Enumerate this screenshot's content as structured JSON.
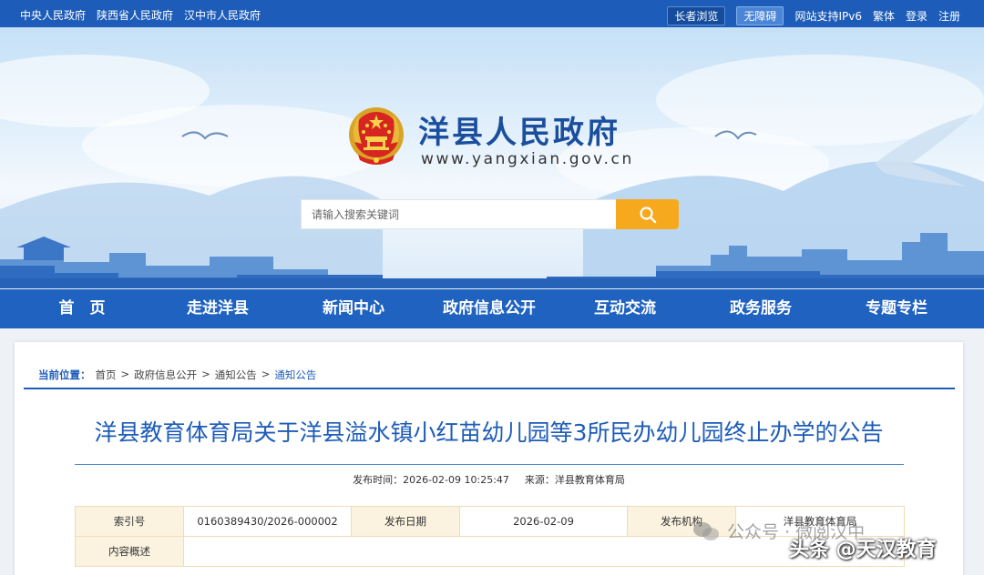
{
  "topbar": {
    "links": [
      "中央人民政府",
      "陕西省人民政府",
      "汉中市人民政府"
    ],
    "elder_mode": "长者浏览",
    "accessible": "无障碍",
    "ipv6": "网站支持IPv6",
    "traditional": "繁体",
    "login": "登录",
    "register": "注册"
  },
  "header": {
    "site_title": "洋县人民政府",
    "site_url": "www.yangxian.gov.cn"
  },
  "search": {
    "placeholder": "请输入搜索关键词",
    "icon": "search-icon"
  },
  "nav": {
    "items": [
      "首　页",
      "走进洋县",
      "新闻中心",
      "政府信息公开",
      "互动交流",
      "政务服务",
      "专题专栏"
    ]
  },
  "breadcrumb": {
    "label": "当前位置：",
    "items": [
      "首页",
      "政府信息公开",
      "通知公告"
    ],
    "separator": ">",
    "current": "通知公告"
  },
  "article": {
    "title": "洋县教育体育局关于洋县溢水镇小红苗幼儿园等3所民办幼儿园终止办学的公告",
    "publish_label": "发布时间：",
    "publish_time": "2026-02-09 10:25:47",
    "source_label": "来源：",
    "source": "洋县教育体育局"
  },
  "info_table": {
    "index_label": "索引号",
    "index_value": "0160389430/2026-000002",
    "date_label": "发布日期",
    "date_value": "2026-02-09",
    "org_label": "发布机构",
    "org_value": "洋县教育体育局",
    "summary_label": "内容概述",
    "summary_value": ""
  },
  "watermark": {
    "wechat": "公众号 · 微阅汉中",
    "toutiao": "头条 @天汉教育"
  },
  "colors": {
    "primary": "#1d5cb8",
    "nav": "#1f62bf",
    "search_button": "#f7a91e",
    "table_border": "#f1dcb5",
    "table_key_bg": "#fbf2df"
  }
}
